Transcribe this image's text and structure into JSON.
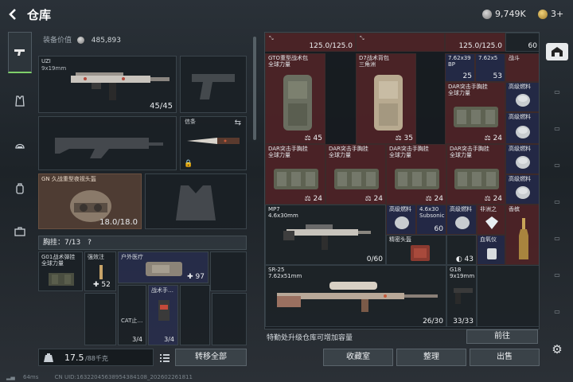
{
  "header": {
    "title": "仓库",
    "currency_silver": "9,749K",
    "currency_gold": "3+"
  },
  "equip": {
    "value_label": "装备价值",
    "value": "485,893"
  },
  "weapon_slot": {
    "name": "UZI",
    "caliber": "9x19mm",
    "ammo": "45/45"
  },
  "melee_slot": {
    "name": "信条"
  },
  "helmet_slot": {
    "name": "GN 久战重型夜视头盔",
    "durability": "18.0/18.0"
  },
  "chest": {
    "label": "胸挂：7/13",
    "help": "?",
    "items": [
      {
        "name": "G01战术弹挂",
        "sub": "全球力量"
      },
      {
        "name": "强效注",
        "count": "52"
      },
      {
        "name": "户外医疗",
        "count": "97"
      },
      {
        "name": "战术手…",
        "count": "3/4"
      },
      {
        "name": "CAT止…",
        "count": "3/4"
      }
    ]
  },
  "weight": {
    "value": "17.5",
    "unit": "/88千克"
  },
  "buttons": {
    "transfer_all": "转移全部",
    "goto": "前往",
    "collection": "收藏室",
    "organize": "整理",
    "sell": "出售"
  },
  "storage": {
    "top_counts": [
      "125.0/125.0",
      "125.0/125.0",
      "60"
    ],
    "items": [
      {
        "name": "GTO重型战术包",
        "sub": "全球力量",
        "count": "45"
      },
      {
        "name": "D7战术背包",
        "sub": "三角洲",
        "count": "35"
      },
      {
        "name": "7.62x39",
        "sub": "BP",
        "count": "25"
      },
      {
        "name": "7.62x5",
        "sub": "",
        "count": "53"
      },
      {
        "name": "战斗",
        "sub": "",
        "count": ""
      },
      {
        "name": "DAR突击手胸挂",
        "sub": "全球力量",
        "count": "24"
      },
      {
        "name": "高级燃料",
        "sub": "",
        "count": ""
      },
      {
        "name": "高级燃料",
        "sub": "",
        "count": ""
      },
      {
        "name": "DAR突击手胸挂",
        "sub": "全球力量",
        "count": "24"
      },
      {
        "name": "DAR突击手胸挂",
        "sub": "全球力量",
        "count": "24"
      },
      {
        "name": "DAR突击手胸挂",
        "sub": "全球力量",
        "count": "24"
      },
      {
        "name": "DAR突击手胸挂",
        "sub": "全球力量",
        "count": "24"
      },
      {
        "name": "高级燃料",
        "sub": "",
        "count": ""
      },
      {
        "name": "高级燃料",
        "sub": "",
        "count": ""
      },
      {
        "name": "MP7",
        "sub": "4.6x30mm",
        "count": "0/60"
      },
      {
        "name": "高级燃料",
        "sub": "",
        "count": ""
      },
      {
        "name": "4.6x30",
        "sub": "Subsonic",
        "count": "60"
      },
      {
        "name": "高级燃料",
        "sub": "",
        "count": ""
      },
      {
        "name": "非洲之",
        "sub": "",
        "count": ""
      },
      {
        "name": "香槟",
        "sub": "",
        "count": ""
      },
      {
        "name": "精密头盔",
        "sub": "",
        "count": "43"
      },
      {
        "name": "血氧仪",
        "sub": "",
        "count": ""
      },
      {
        "name": "SR-25",
        "sub": "7.62x51mm",
        "count": "26/30"
      },
      {
        "name": "G18",
        "sub": "9x19mm",
        "count": "33/33"
      }
    ]
  },
  "upgrade_tip": "特勤处升级仓库可增加容量",
  "footer": {
    "ping": "64ms",
    "uid": "CN UID:16322045638954384108_202602261811"
  }
}
